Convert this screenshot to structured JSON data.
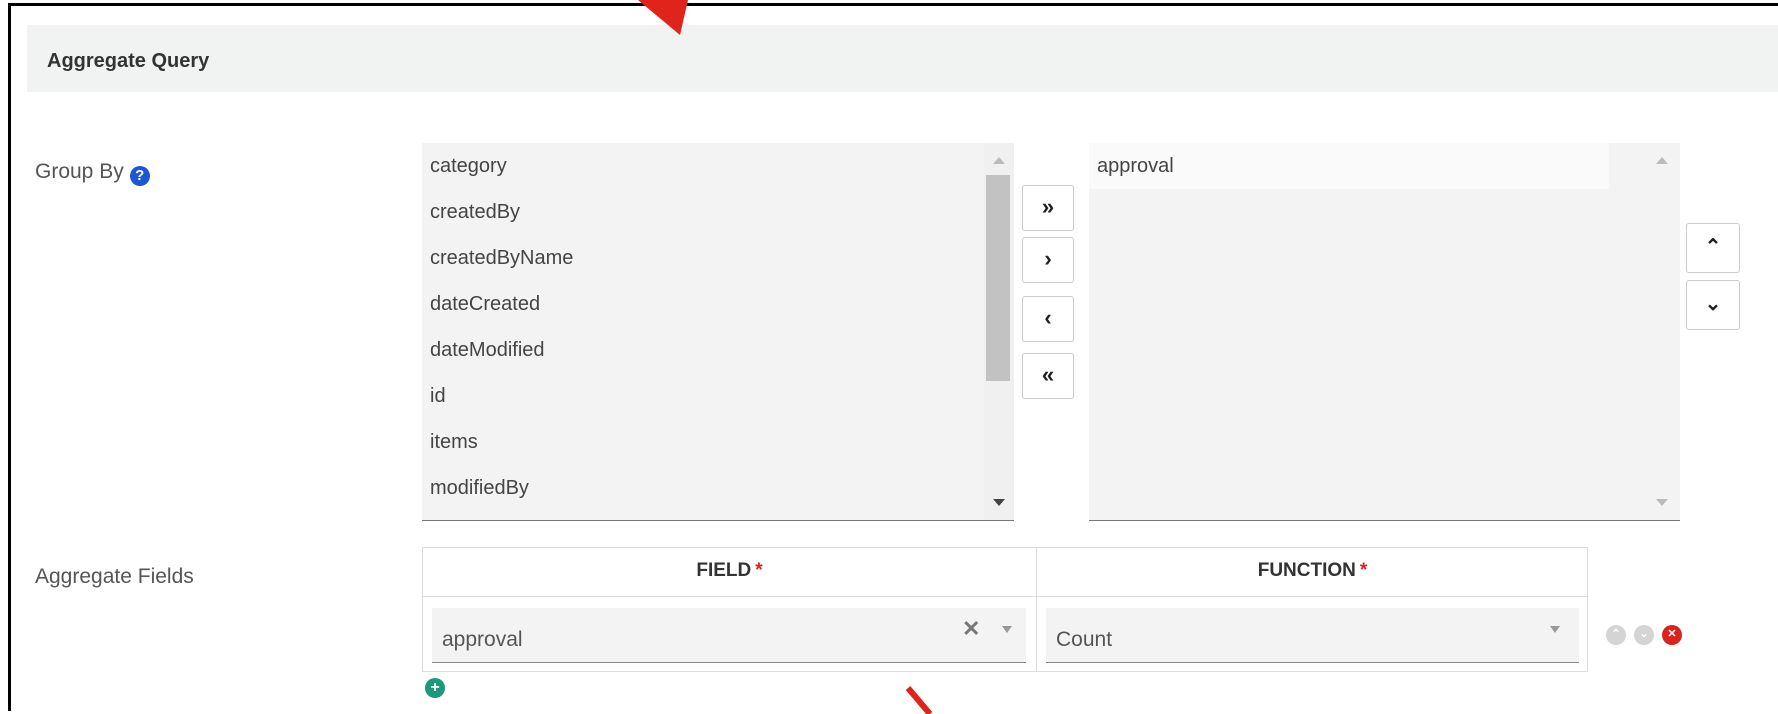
{
  "panel": {
    "title": "Aggregate Query"
  },
  "group_by": {
    "label": "Group By",
    "help_icon": "question-circle-icon",
    "available_fields": [
      "category",
      "createdBy",
      "createdByName",
      "dateCreated",
      "dateModified",
      "id",
      "items",
      "modifiedBy"
    ],
    "selected_fields": [
      "approval"
    ],
    "transfer_buttons": {
      "move_all_right": "»",
      "move_right": "›",
      "move_left": "‹",
      "move_all_left": "«"
    },
    "order_buttons": {
      "up": "⌃",
      "down": "⌄"
    }
  },
  "aggregate_fields": {
    "label": "Aggregate Fields",
    "columns": [
      {
        "header": "FIELD",
        "required_mark": "*"
      },
      {
        "header": "FUNCTION",
        "required_mark": "*"
      }
    ],
    "rows": [
      {
        "field": "approval",
        "function": "Count"
      }
    ],
    "clear_glyph": "✕",
    "remove_glyph": "✕",
    "add_glyph": "+",
    "icons": [
      "chevron-up-circle-icon",
      "chevron-down-circle-icon",
      "remove-circle-icon",
      "add-circle-icon"
    ],
    "colors": {
      "remove": "#d9231c",
      "add": "#1a9a7a",
      "help": "#1c56d4",
      "required": "#d9231c"
    }
  },
  "annotations": {
    "arrow_color": "#e0241b"
  }
}
